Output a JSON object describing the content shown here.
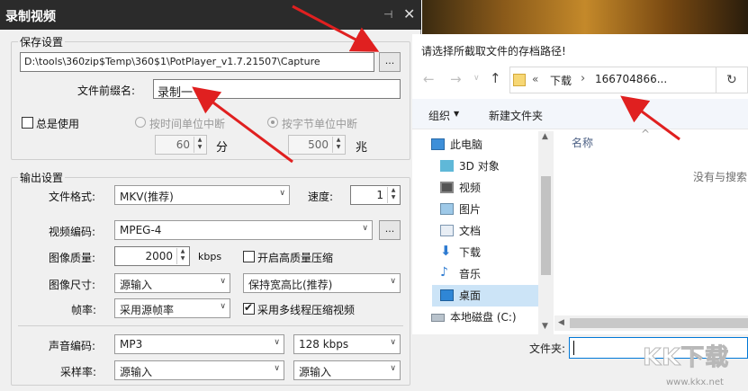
{
  "recorder": {
    "title": "录制视频",
    "save_group": {
      "title": "保存设置",
      "path": "D:\\tools\\360zip$Temp\\360$1\\PotPlayer_v1.7.21507\\Capture",
      "browse_label": "...",
      "prefix_label": "文件前缀名:",
      "prefix_value": "录制一",
      "always_use": "总是使用",
      "split_by_time": "按时间单位中断",
      "split_by_size": "按字节单位中断",
      "time_value": "60",
      "time_unit": "分",
      "size_value": "500",
      "size_unit": "兆"
    },
    "output_group": {
      "title": "输出设置",
      "format_label": "文件格式:",
      "format_value": "MKV(推荐)",
      "speed_label": "速度:",
      "speed_value": "1",
      "video_codec_label": "视频编码:",
      "video_codec_value": "MPEG-4",
      "codec_options_label": "...",
      "quality_label": "图像质量:",
      "quality_value": "2000",
      "quality_unit": "kbps",
      "hq_label": "开启高质量压缩",
      "size_label": "图像尺寸:",
      "size_value": "源输入",
      "aspect_value": "保持宽高比(推荐)",
      "fps_label": "帧率:",
      "fps_value": "采用源帧率",
      "mt_label": "采用多线程压缩视频",
      "audio_codec_label": "声音编码:",
      "audio_codec_value": "MP3",
      "audio_bitrate_value": "128 kbps",
      "samplerate_label": "采样率:",
      "samplerate_value": "源输入",
      "channels_value": "源输入"
    }
  },
  "file_dialog": {
    "title": "请选择所截取文件的存档路径!",
    "breadcrumb_sep": "«",
    "crumb1": "下载",
    "crumb_arrow": "›",
    "crumb2": "166704866...",
    "organize": "组织",
    "new_folder": "新建文件夹",
    "nav": [
      "此电脑",
      "3D 对象",
      "视频",
      "图片",
      "文档",
      "下载",
      "音乐",
      "桌面",
      "本地磁盘 (C:)"
    ],
    "col_name": "名称",
    "empty_text": "没有与搜索",
    "filename_label": "文件夹:",
    "filename_value": ""
  },
  "watermark": {
    "logo": "KK下载",
    "url": "www.kkx.net"
  },
  "colors": {
    "titlebar": "#2b2b2b",
    "accent_blue": "#0078d7",
    "selection": "#cce4f7",
    "annotation_red": "#e02020"
  }
}
